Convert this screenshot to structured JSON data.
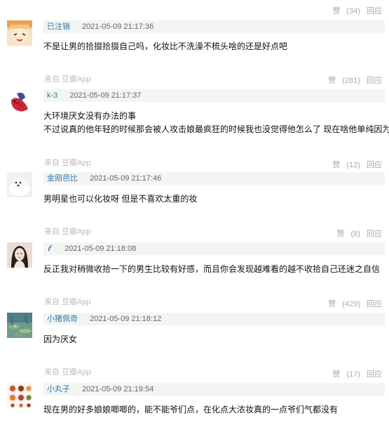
{
  "top": {
    "like_label": "赞",
    "like_count": "(34)",
    "reply_label": "回应"
  },
  "comments": [
    {
      "username": "已注销",
      "time": "2021-05-09 21:17:36",
      "content_lines": [
        "不是让男的拾掇拾掇自己吗，化妆比不洗澡不梳头啥的还是好点吧"
      ],
      "source": "来自 豆瓣App",
      "like_label": "赞",
      "like_count": "(281)",
      "reply_label": "回应",
      "avatar_icon": "cartoon-girl-avatar-icon"
    },
    {
      "username": "k-3",
      "time": "2021-05-09 21:17:37",
      "content_lines": [
        "大环境厌女没有办法的事",
        "不过说真的他年轻的时候那会被人攻击娘最疯狂的时候我也没觉得他怎么了 现在啥他单纯因为丑"
      ],
      "source": "来自 豆瓣App",
      "like_label": "赞",
      "like_count": "(12)",
      "reply_label": "回应",
      "avatar_icon": "betta-fish-avatar-icon"
    },
    {
      "username": "金刚芭比",
      "time": "2021-05-09 21:17:46",
      "content_lines": [
        "男明星也可以化妆呀 但是不喜欢太重的妆"
      ],
      "source": "来自 豆瓣App",
      "like_label": "赞",
      "like_count": "(8)",
      "reply_label": "回应",
      "avatar_icon": "white-dog-avatar-icon"
    },
    {
      "username": "",
      "time": "2021-05-09 21:18:08",
      "content_lines": [
        "反正我对稍微收拾一下的男生比较有好感，而且你会发现越难看的越不收拾自己还迷之自信"
      ],
      "source": "来自 豆瓣App",
      "like_label": "赞",
      "like_count": "(429)",
      "reply_label": "回应",
      "avatar_icon": "woman-portrait-avatar-icon"
    },
    {
      "username": "小猪佩奇",
      "time": "2021-05-09 21:18:12",
      "content_lines": [
        "因为厌女"
      ],
      "source": "来自 豆瓣App",
      "like_label": "赞",
      "like_count": "(17)",
      "reply_label": "回应",
      "avatar_icon": "water-lilies-avatar-icon"
    },
    {
      "username": "小丸子",
      "time": "2021-05-09 21:19:54",
      "content_lines": [
        "现在男的好多娘娘唧唧的，能不能爷们点，在化点大浓妆真的一点爷们气都没有"
      ],
      "avatar_icon": "food-dishes-avatar-icon"
    }
  ],
  "colors": {
    "username": "#3377aa",
    "meta_bg": "#f2f5f2",
    "muted": "#aaaaaa"
  }
}
